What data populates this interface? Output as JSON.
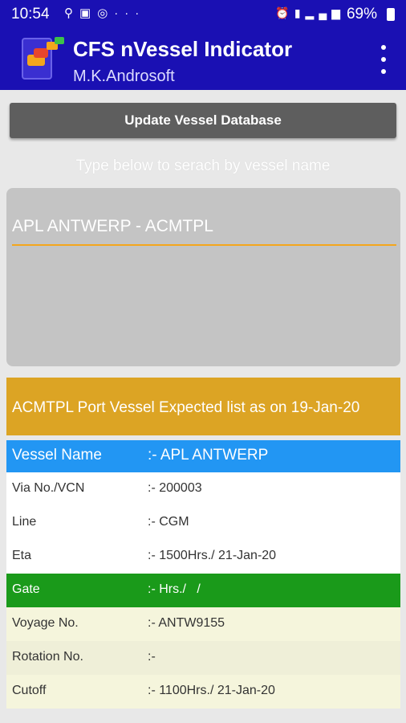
{
  "status_bar": {
    "time": "10:54",
    "left_icons": [
      "volte-icon",
      "image-icon",
      "at-icon",
      "more-icon"
    ],
    "battery_pct": "69%"
  },
  "app_bar": {
    "title": "CFS nVessel Indicator",
    "subtitle": "M.K.Androsoft"
  },
  "update_button_label": "Update Vessel Database",
  "search": {
    "hint": "Type below to serach by vessel name",
    "value": "APL ANTWERP - ACMTPL"
  },
  "banner_text": "ACMTPL Port Vessel Expected list as on 19-Jan-20",
  "details": [
    {
      "label": "Vessel Name",
      "value": ":- APL ANTWERP"
    },
    {
      "label": "Via No./VCN",
      "value": ":- 200003"
    },
    {
      "label": "Line",
      "value": ":- CGM"
    },
    {
      "label": "Eta",
      "value": ":- 1500Hrs./ 21-Jan-20"
    },
    {
      "label": "Gate",
      "value": ":- Hrs./   /"
    },
    {
      "label": "Voyage No.",
      "value": ":- ANTW9155"
    },
    {
      "label": "Rotation No.",
      "value": ":-"
    },
    {
      "label": "Cutoff",
      "value": ":- 1100Hrs./ 21-Jan-20"
    }
  ],
  "colors": {
    "app_bar": "#1a10b3",
    "banner": "#dca424",
    "header_row": "#2296f3",
    "gate_row": "#1a9a1a",
    "input_underline": "#f4a61c"
  }
}
